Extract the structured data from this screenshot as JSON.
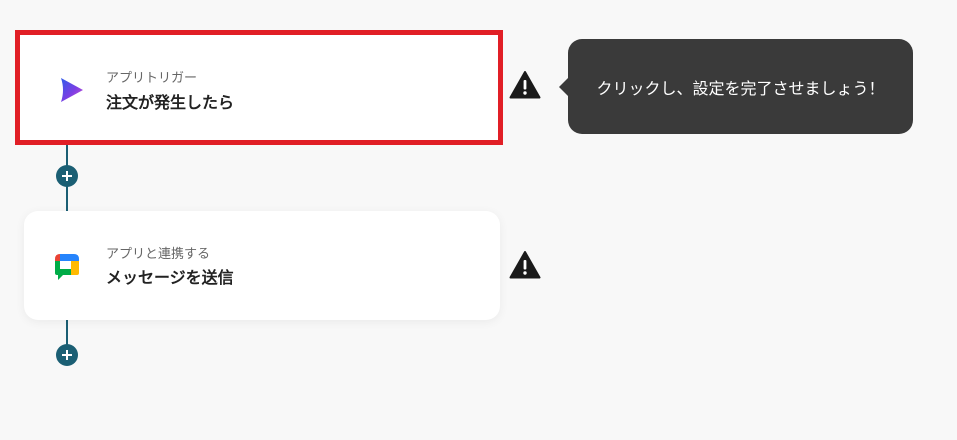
{
  "steps": [
    {
      "subtitle": "アプリトリガー",
      "title": "注文が発生したら",
      "icon": "play-triangle-icon",
      "selected": true
    },
    {
      "subtitle": "アプリと連携する",
      "title": "メッセージを送信",
      "icon": "google-chat-icon",
      "selected": false
    }
  ],
  "tooltip": {
    "text": "クリックし、設定を完了させましょう！"
  },
  "colors": {
    "accent": "#1b5f74",
    "highlight_border": "#e11f26",
    "tooltip_bg": "#3a3a3a",
    "background": "#f8f8f8"
  }
}
